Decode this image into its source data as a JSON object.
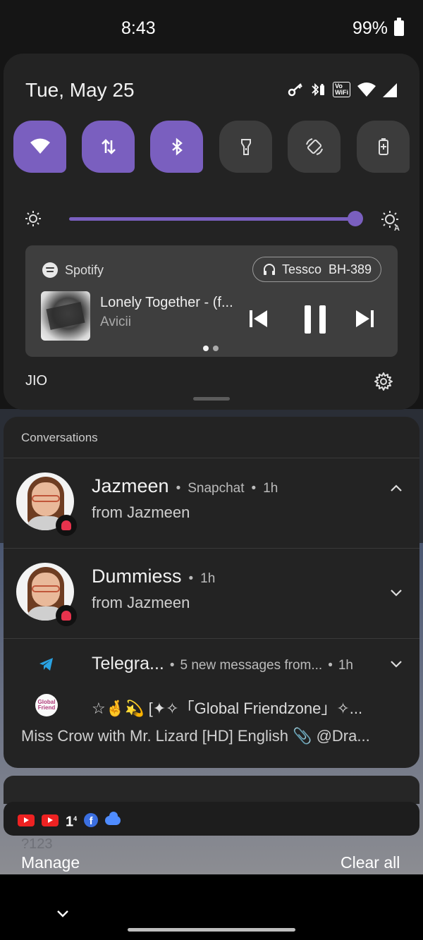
{
  "status_bar": {
    "time": "8:43",
    "battery": "99%"
  },
  "quick_settings": {
    "date": "Tue, May 25",
    "tiles": [
      {
        "name": "wifi",
        "on": true
      },
      {
        "name": "mobile-data",
        "on": true
      },
      {
        "name": "bluetooth",
        "on": true
      },
      {
        "name": "flashlight",
        "on": false
      },
      {
        "name": "auto-rotate",
        "on": false
      },
      {
        "name": "battery-saver",
        "on": false
      }
    ],
    "brightness_level": 1.0,
    "carrier": "JIO"
  },
  "media": {
    "app": "Spotify",
    "output_device": "Tessco  BH-389",
    "title": "Lonely Together - (f...",
    "artist": "Avicii",
    "page_count": 2,
    "active_page": 1
  },
  "conversations": {
    "header": "Conversations",
    "items": [
      {
        "name": "Jazmeen",
        "app": "Snapchat",
        "time": "1h",
        "preview": "from Jazmeen",
        "expanded": true
      },
      {
        "name": "Dummiess",
        "time": "1h",
        "preview": "from Jazmeen",
        "expanded": false
      }
    ]
  },
  "telegram": {
    "app": "Telegra...",
    "summary": "5 new messages from...",
    "time": "1h",
    "group_avatar_text": "Global Friend",
    "line1": "☆🤞💫 [✦✧「Global Friendzone」✧...",
    "line2": "Miss Crow with Mr. Lizard [HD] English 📎 @Dra..."
  },
  "silent_icons": [
    "youtube-icon",
    "youtube-icon",
    "one-icon",
    "facebook-icon",
    "cloud-icon"
  ],
  "silent_one_label": "1",
  "footer": {
    "keyboard_ghost": "?123",
    "manage": "Manage",
    "clear_all": "Clear all"
  },
  "colors": {
    "accent": "#7a5fbf",
    "panel": "#232323",
    "tile_off": "#3c3c3c",
    "snapchat": "#e8334d",
    "telegram": "#2aa3e3"
  }
}
